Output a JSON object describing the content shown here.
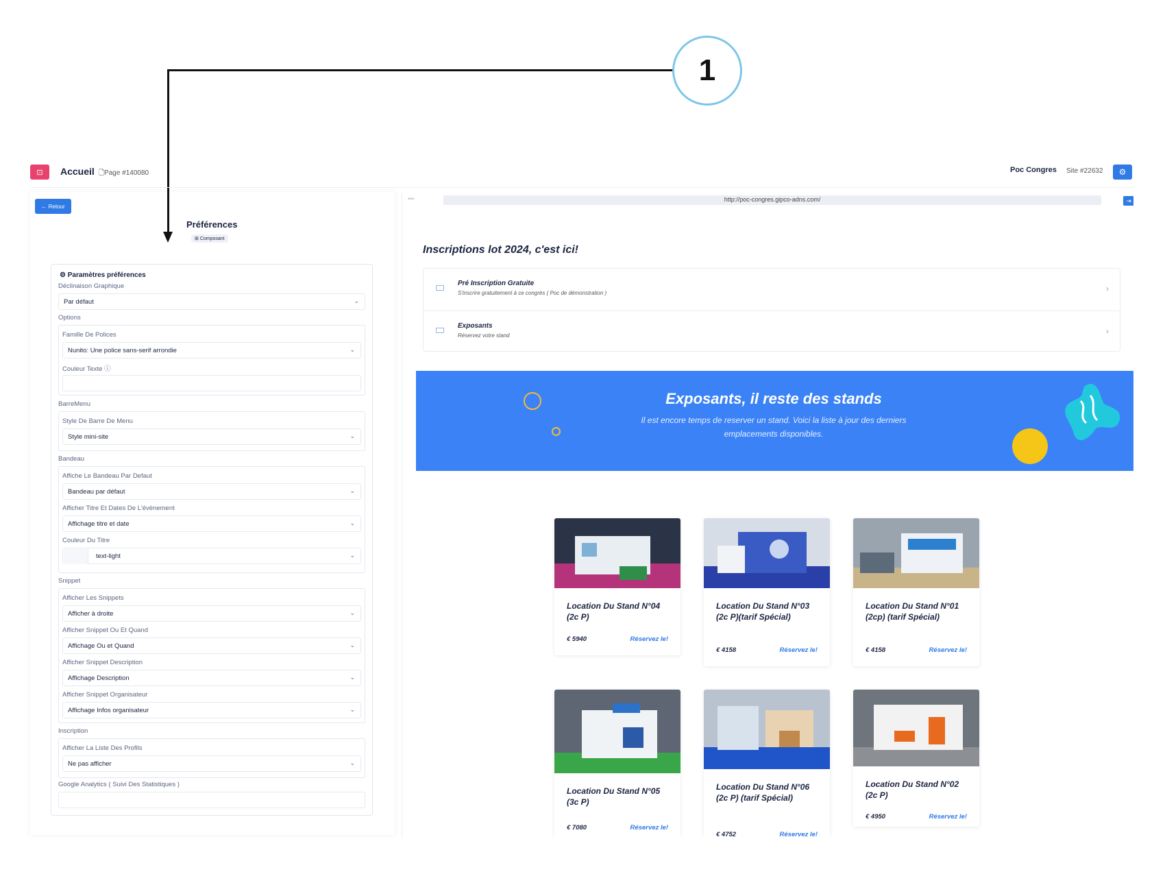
{
  "callout": {
    "number": "1"
  },
  "topbar": {
    "title": "Accueil",
    "page_ref": "Page #140080",
    "site_name": "Poc Congres",
    "site_id": "Site #22632"
  },
  "left": {
    "back_label": "← Retour",
    "title": "Préférences",
    "badge": "Composant",
    "panel_title": "Paramètres préférences",
    "declinaison_label": "Déclinaison Graphique",
    "declinaison_value": "Par défaut",
    "options_label": "Options",
    "font_family_label": "Famille De Polices",
    "font_family_value": "Nunito: Une police sans-serif arrondie",
    "text_color_label": "Couleur Texte",
    "text_color_value": "",
    "barremenu_label": "BarreMenu",
    "menu_style_label": "Style De Barre De Menu",
    "menu_style_value": "Style mini-site",
    "bandeau_label": "Bandeau",
    "bandeau_default_label": "Affiche Le Bandeau Par Defaut",
    "bandeau_default_value": "Bandeau par défaut",
    "title_dates_label": "Afficher Titre Et Dates De L'évènement",
    "title_dates_value": "Affichage titre et date",
    "title_color_label": "Couleur Du Titre",
    "title_color_value": "text-light",
    "snippet_label": "Snippet",
    "show_snippets_label": "Afficher Les Snippets",
    "show_snippets_value": "Afficher à droite",
    "snippet_where_label": "Afficher Snippet Ou Et Quand",
    "snippet_where_value": "Affichage Ou et Quand",
    "snippet_desc_label": "Afficher Snippet Description",
    "snippet_desc_value": "Affichage Description",
    "snippet_org_label": "Afficher Snippet Organisateur",
    "snippet_org_value": "Affichage Infos organisateur",
    "inscription_label": "Inscription",
    "profiles_label": "Afficher La Liste Des Profils",
    "profiles_value": "Ne pas afficher",
    "ga_label": "Google Analytics ( Suivi Des Statistiques )",
    "ga_value": ""
  },
  "preview": {
    "url": "http://poc-congres.gipco-adns.com/",
    "heading": "Inscriptions lot 2024, c'est ici!",
    "registrations": [
      {
        "title": "Pré Inscription Gratuite",
        "subtitle": "S'inscrire gratuitement à ce congrès ( Poc de démonstration )"
      },
      {
        "title": "Exposants",
        "subtitle": "Réservez votre stand"
      }
    ],
    "banner_title": "Exposants, il reste des stands",
    "banner_subtitle": "Il est encore temps de reserver un stand. Voici la liste à jour des derniers emplacements disponibles.",
    "cta_label": "Réservez le!",
    "cards": [
      {
        "title": "Location Du Stand N°04 (2c P)",
        "price": "€ 5940"
      },
      {
        "title": "Location Du Stand N°03 (2c P)(tarif Spécial)",
        "price": "€ 4158"
      },
      {
        "title": "Location Du Stand N°01 (2cp) (tarif Spécial)",
        "price": "€ 4158"
      },
      {
        "title": "Location Du Stand N°05 (3c P)",
        "price": "€ 7080"
      },
      {
        "title": "Location Du Stand N°06 (2c P) (tarif Spécial)",
        "price": "€ 4752"
      },
      {
        "title": "Location Du Stand N°02 (2c P)",
        "price": "€ 4950"
      }
    ]
  },
  "colors": {
    "accent": "#2f7ae5",
    "brand": "#e8436e",
    "banner": "#3b82f6",
    "callout_ring": "#7cc6e8"
  }
}
